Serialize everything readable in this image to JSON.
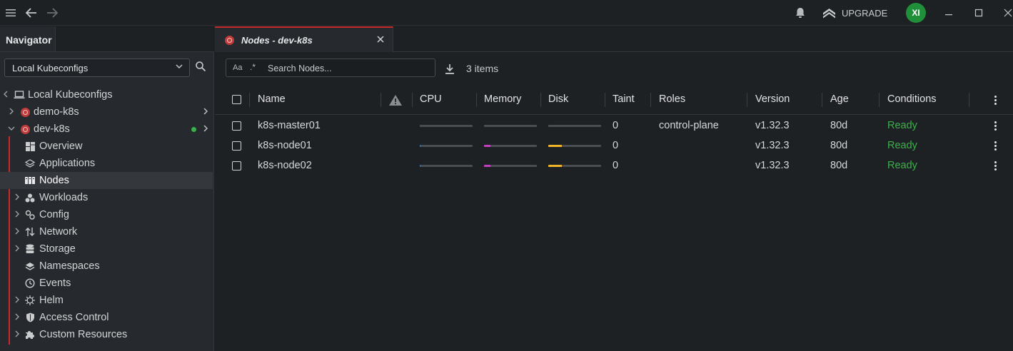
{
  "topbar": {
    "menu_icon": "hamburger-icon",
    "back_icon": "arrow-left-icon",
    "forward_icon": "arrow-right-icon",
    "bell_icon": "bell-icon",
    "upgrade_label": "UPGRADE",
    "avatar_initials": "XI"
  },
  "sidebar": {
    "tab_label": "Navigator",
    "kubeconfig_select": "Local Kubeconfigs",
    "root_label": "Local Kubeconfigs",
    "clusters": [
      {
        "label": "demo-k8s"
      },
      {
        "label": "dev-k8s",
        "status": "connected"
      }
    ],
    "items": [
      {
        "label": "Overview",
        "icon": "dashboard-icon"
      },
      {
        "label": "Applications",
        "icon": "applications-icon"
      },
      {
        "label": "Nodes",
        "icon": "nodes-icon",
        "selected": true
      },
      {
        "label": "Workloads",
        "icon": "workloads-icon"
      },
      {
        "label": "Config",
        "icon": "config-icon"
      },
      {
        "label": "Network",
        "icon": "network-icon"
      },
      {
        "label": "Storage",
        "icon": "storage-icon"
      },
      {
        "label": "Namespaces",
        "icon": "layers-icon"
      },
      {
        "label": "Events",
        "icon": "clock-icon"
      },
      {
        "label": "Helm",
        "icon": "helm-icon"
      },
      {
        "label": "Access Control",
        "icon": "shield-icon"
      },
      {
        "label": "Custom Resources",
        "icon": "puzzle-icon"
      }
    ]
  },
  "main": {
    "tab_title": "Nodes - dev-k8s",
    "search": {
      "case_label": "Aa",
      "regex_label": ".*",
      "placeholder": "Search Nodes..."
    },
    "items_count": "3 items",
    "columns": [
      "Name",
      "CPU",
      "Memory",
      "Disk",
      "Taints",
      "Roles",
      "Version",
      "Age",
      "Conditions"
    ],
    "taints_header_visible": "Taint",
    "rows": [
      {
        "name": "k8s-master01",
        "cpu": 0,
        "memory": 0,
        "disk": 0,
        "taints": "0",
        "roles": "control-plane",
        "version": "v1.32.3",
        "age": "80d",
        "conditions": "Ready"
      },
      {
        "name": "k8s-node01",
        "cpu": 0.02,
        "memory": 0.12,
        "disk": 0.25,
        "taints": "0",
        "roles": "",
        "version": "v1.32.3",
        "age": "80d",
        "conditions": "Ready"
      },
      {
        "name": "k8s-node02",
        "cpu": 0.02,
        "memory": 0.12,
        "disk": 0.25,
        "taints": "0",
        "roles": "",
        "version": "v1.32.3",
        "age": "80d",
        "conditions": "Ready"
      }
    ],
    "colors": {
      "cpu": "#3b82c4",
      "memory": "#c040c0",
      "disk": "#f0b429",
      "ready": "#3cb04a",
      "accent": "#c92a2a"
    }
  }
}
